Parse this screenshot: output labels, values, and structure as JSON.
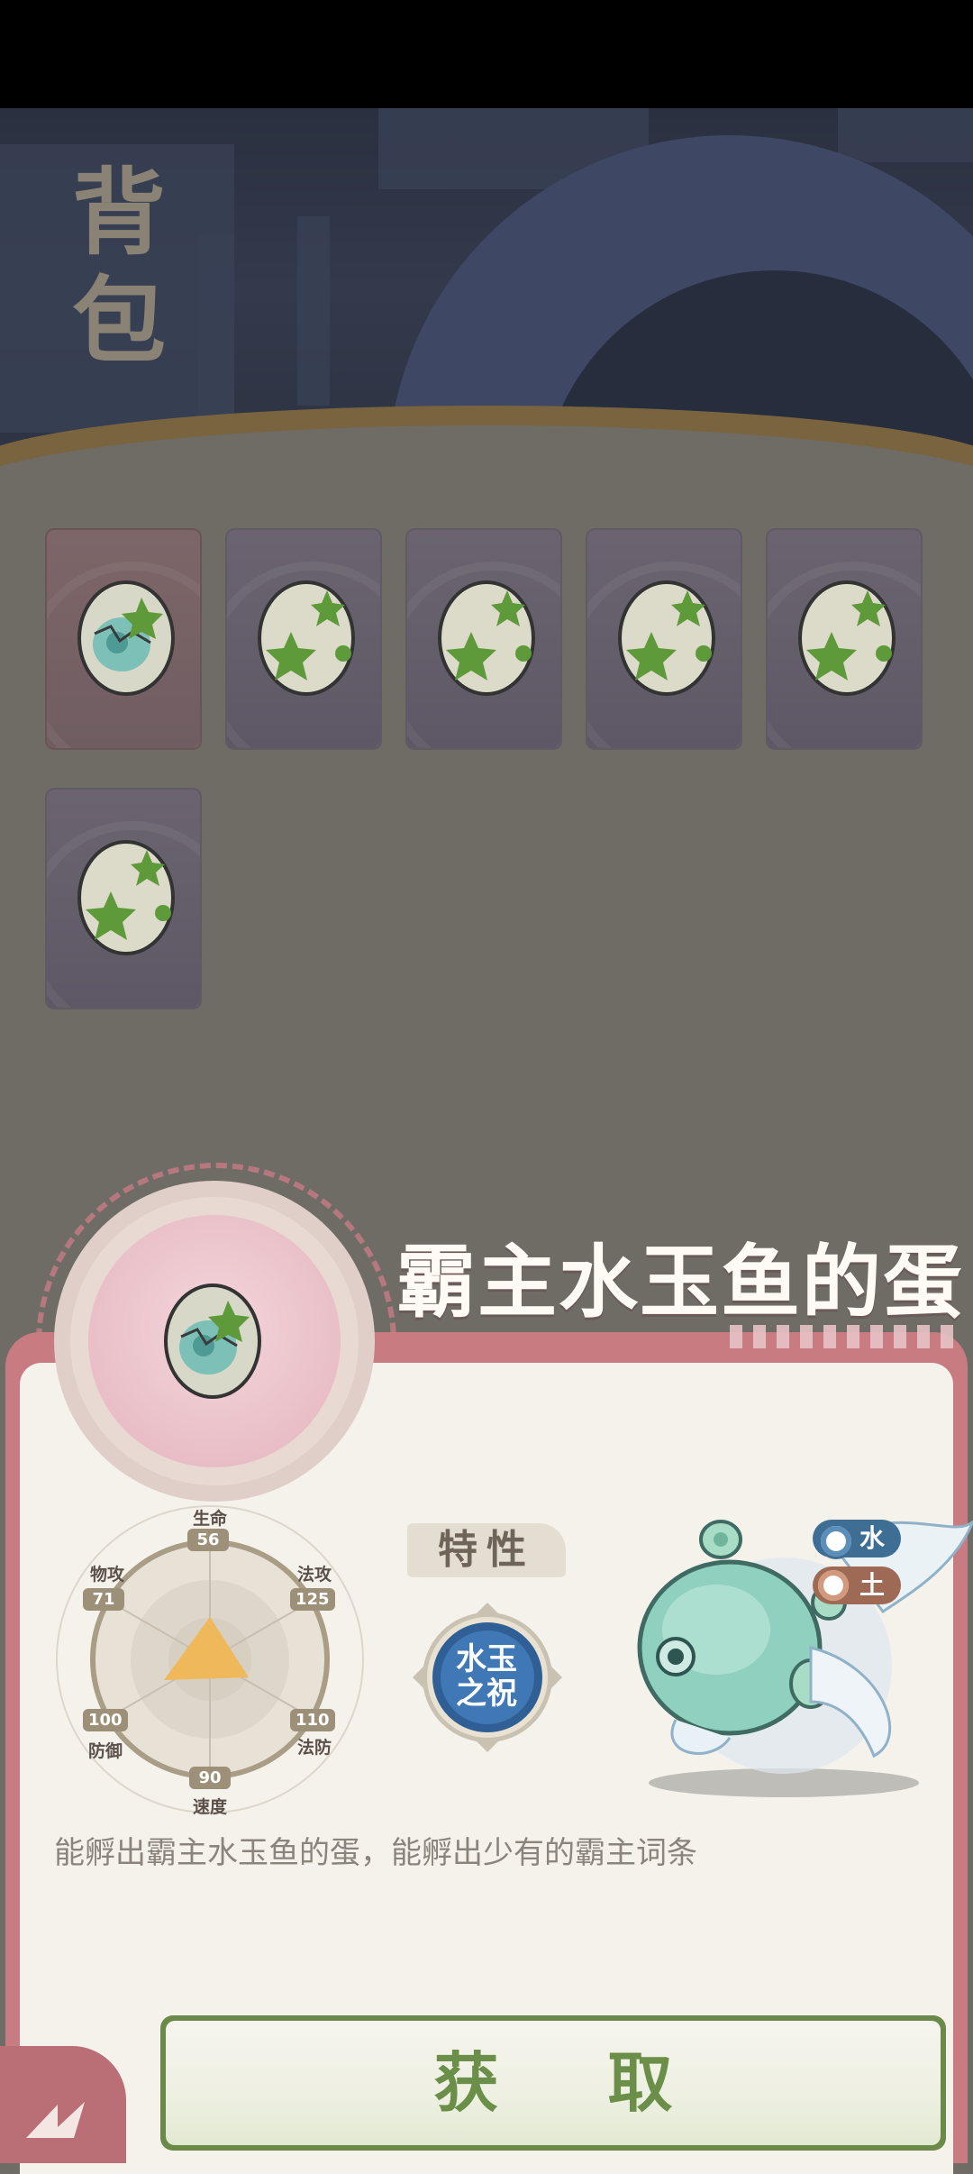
{
  "header": {
    "title_chars": [
      "背",
      "包"
    ]
  },
  "inventory": {
    "items": [
      {
        "name": "霸主水玉鱼的蛋",
        "selected": true
      },
      {
        "name": "egg-2",
        "selected": false
      },
      {
        "name": "egg-3",
        "selected": false
      },
      {
        "name": "egg-4",
        "selected": false
      },
      {
        "name": "egg-5",
        "selected": false
      },
      {
        "name": "egg-6",
        "selected": false
      }
    ]
  },
  "detail": {
    "name": "霸主水玉鱼的蛋",
    "stats": {
      "hp": {
        "label": "生命",
        "value": "56"
      },
      "atk": {
        "label": "物攻",
        "value": "71"
      },
      "matk": {
        "label": "法攻",
        "value": "125"
      },
      "def": {
        "label": "防御",
        "value": "100"
      },
      "mdef": {
        "label": "法防",
        "value": "110"
      },
      "spd": {
        "label": "速度",
        "value": "90"
      }
    },
    "trait_label": "特性",
    "trait_line1": "水玉",
    "trait_line2": "之祝",
    "elements": [
      {
        "label": "水",
        "icon": "water-icon",
        "color": "#3f6e95"
      },
      {
        "label": "土",
        "icon": "earth-icon",
        "color": "#9e6a56"
      }
    ],
    "description": "能孵出霸主水玉鱼的蛋，能孵出少有的霸主词条"
  },
  "actions": {
    "get_label": "获 取",
    "back_icon": "back-icon"
  },
  "colors": {
    "panel_border": "#c87c82",
    "button_text": "#6b8e48",
    "card_purple": "#5e5866"
  }
}
